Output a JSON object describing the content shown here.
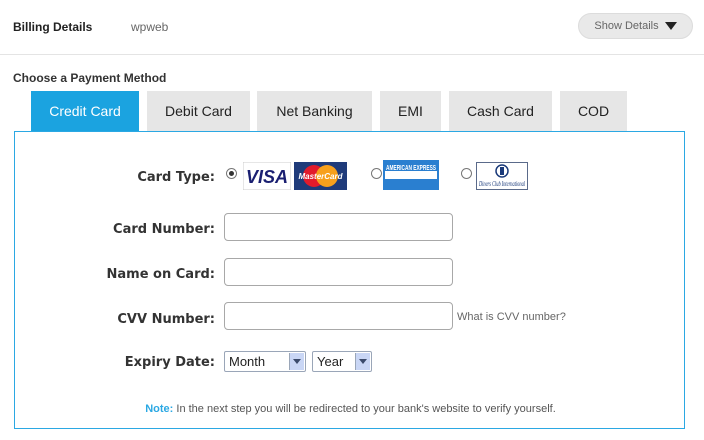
{
  "header": {
    "title": "Billing Details",
    "merchant": "wpweb",
    "show_details_label": "Show Details"
  },
  "payment": {
    "heading": "Choose a Payment Method",
    "tabs": [
      {
        "label": "Credit Card",
        "active": true
      },
      {
        "label": "Debit Card",
        "active": false
      },
      {
        "label": "Net Banking",
        "active": false
      },
      {
        "label": "EMI",
        "active": false
      },
      {
        "label": "Cash Card",
        "active": false
      },
      {
        "label": "COD",
        "active": false
      }
    ]
  },
  "form": {
    "card_type_label": "Card Type:",
    "card_types": [
      {
        "logo_text": "VISA",
        "selected": true
      },
      {
        "logo_text": "MasterCard",
        "selected": true
      },
      {
        "logo_text": "AMERICAN EXPRESS",
        "selected": false
      },
      {
        "logo_text": "Diners Club International",
        "selected": false
      }
    ],
    "card_number_label": "Card Number:",
    "card_number_value": "",
    "name_on_card_label": "Name on Card:",
    "name_on_card_value": "",
    "cvv_label": "CVV Number:",
    "cvv_value": "",
    "cvv_help": "What is CVV number?",
    "expiry_label": "Expiry Date:",
    "expiry_month": "Month",
    "expiry_year": "Year"
  },
  "note": {
    "prefix": "Note:",
    "text": " In the next step you will be redirected to your bank's website to verify yourself."
  },
  "colors": {
    "accent": "#1ba3e0",
    "tab_inactive": "#e6e6e6",
    "panel_border": "#2ba8e3"
  }
}
